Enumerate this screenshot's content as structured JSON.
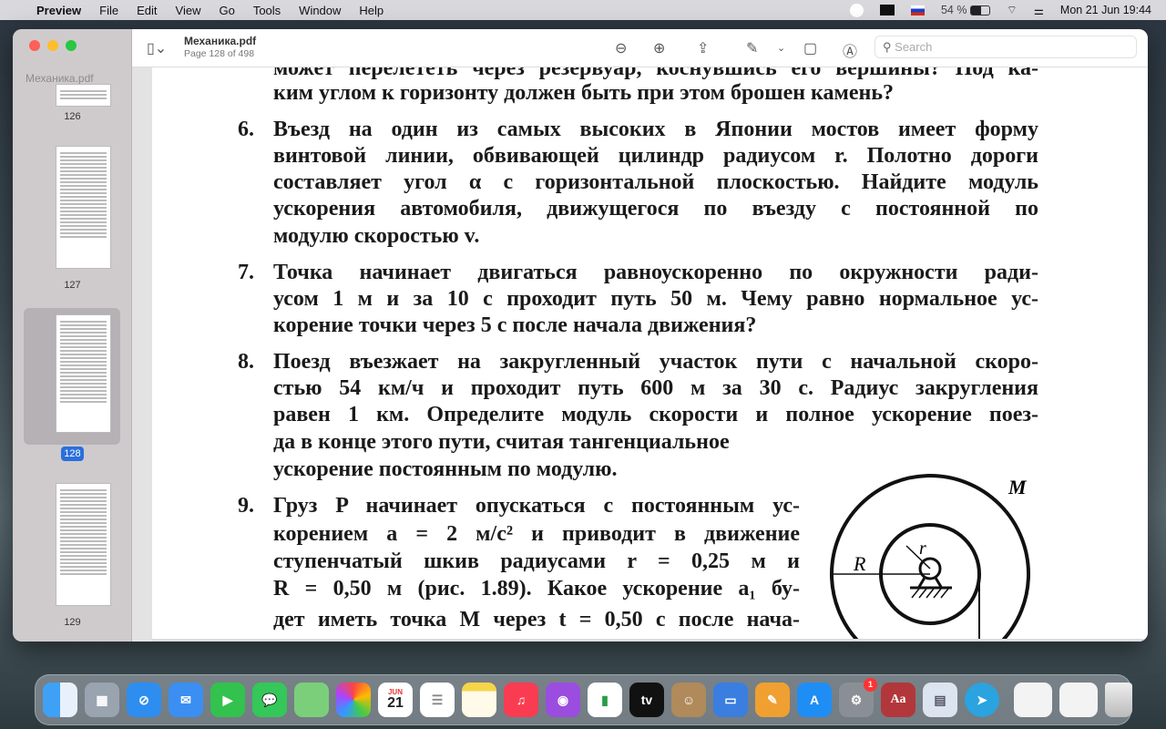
{
  "menubar": {
    "app": "Preview",
    "items": [
      "File",
      "Edit",
      "View",
      "Go",
      "Tools",
      "Window",
      "Help"
    ],
    "battery": "54 %",
    "datetime": "Mon 21 Jun  19:44"
  },
  "sidebar": {
    "title": "Механика.pdf",
    "pages": [
      "126",
      "127",
      "128",
      "129"
    ],
    "selected": "128"
  },
  "toolbar": {
    "title": "Механика.pdf",
    "subtitle": "Page 128 of 498",
    "search_placeholder": "Search"
  },
  "document": {
    "lines": [
      {
        "num": "",
        "text": "может перелететь через резервуар, коснувшись его вершины? Под ка-",
        "just": true
      },
      {
        "num": "",
        "text": "ким углом к горизонту должен быть при этом брошен камень?",
        "just": false
      },
      {
        "num": "6.",
        "text": "Въезд на один из самых высоких в Японии мостов имеет форму",
        "just": true
      },
      {
        "num": "",
        "text": "винтовой линии, обвивающей цилиндр радиусом r. Полотно дороги",
        "just": true
      },
      {
        "num": "",
        "text": "составляет угол α с горизонтальной плоскостью. Найдите модуль",
        "just": true
      },
      {
        "num": "",
        "text": "ускорения автомобиля, движущегося по въезду с постоянной по",
        "just": true
      },
      {
        "num": "",
        "text": "модулю скоростью v.",
        "just": false
      },
      {
        "num": "7.",
        "text": "Точка начинает двигаться равноускоренно по окружности ради-",
        "just": true
      },
      {
        "num": "",
        "text": "усом 1 м и за 10 с проходит путь 50 м. Чему равно нормальное ус-",
        "just": true
      },
      {
        "num": "",
        "text": "корение точки через 5 с после начала движения?",
        "just": false
      },
      {
        "num": "8.",
        "text": "Поезд въезжает на закругленный участок пути с начальной скоро-",
        "just": true
      },
      {
        "num": "",
        "text": "стью 54 км/ч и проходит путь 600 м за 30 с. Радиус закругления",
        "just": true
      },
      {
        "num": "",
        "text": "равен 1 км. Определите модуль скорости и полное ускорение поез-",
        "just": true
      },
      {
        "num": "",
        "text": "да в конце этого пути, считая тангенциальное",
        "just": false
      },
      {
        "num": "",
        "text": "ускорение постоянным по модулю.",
        "just": false
      },
      {
        "num": "9.",
        "text": "Груз P начинает опускаться с постоянным ус-",
        "just": true
      },
      {
        "num": "",
        "text": "корением a = 2 м/с² и приводит в движение",
        "just": true
      },
      {
        "num": "",
        "text": "ступенчатый шкив радиусами r = 0,25 м и",
        "just": true
      },
      {
        "num": "",
        "text": "R = 0,50 м (рис. 1.89). Какое ускорение a₁ бу-",
        "just": true
      },
      {
        "num": "",
        "text": "дет иметь точка M через t = 0,50 с после нача-",
        "just": true
      }
    ],
    "figure": {
      "label_M": "M",
      "label_r": "r",
      "label_R": "R"
    }
  },
  "dock": {
    "calendar_month": "JUN",
    "calendar_day": "21",
    "settings_badge": "1",
    "dictionary": "Aa",
    "tv": "tv"
  }
}
